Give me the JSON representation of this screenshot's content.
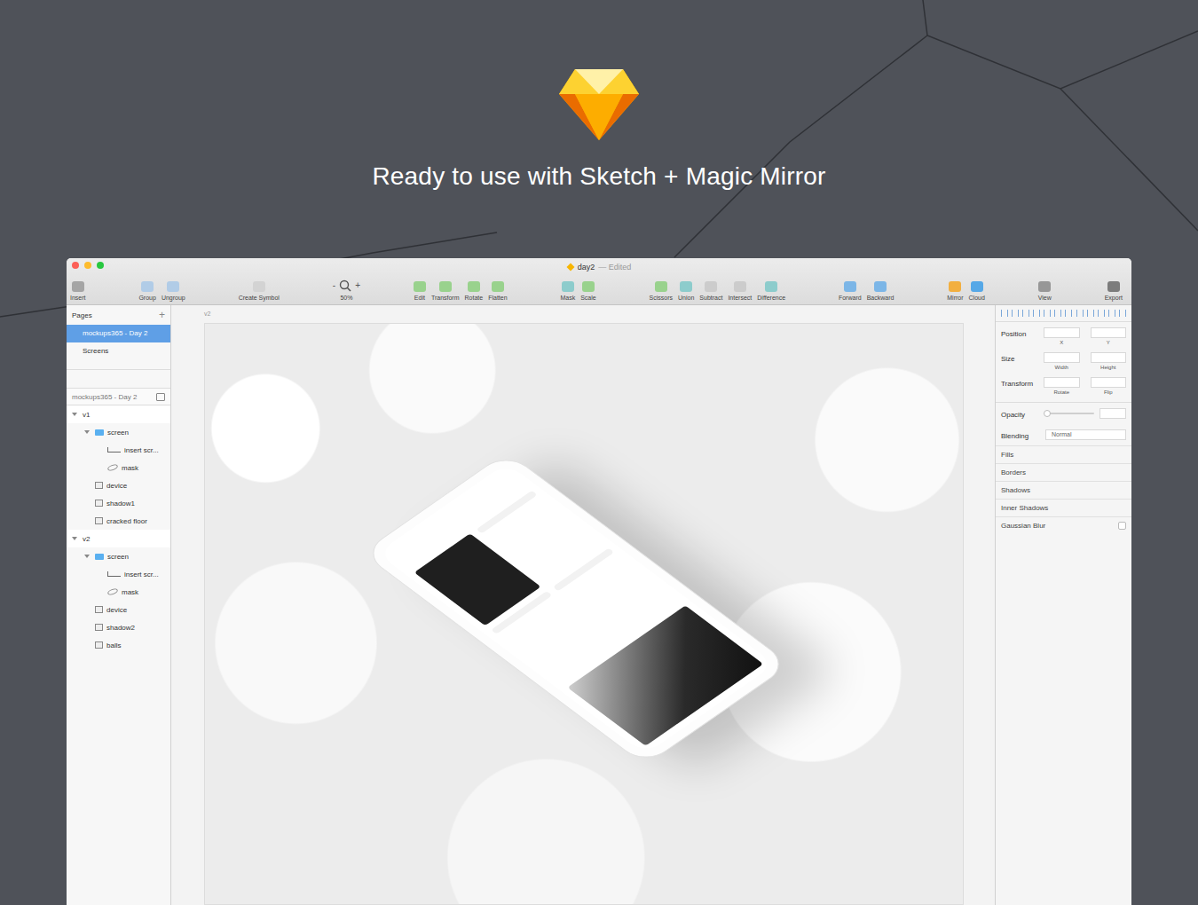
{
  "hero": {
    "title": "Ready to use with Sketch + Magic Mirror"
  },
  "window": {
    "title": "day2",
    "status": "— Edited"
  },
  "toolbar": {
    "groups": [
      [
        {
          "label": "Insert",
          "color": "#9a9a9a"
        }
      ],
      [
        {
          "label": "Group",
          "color": "#a8c8e8"
        },
        {
          "label": "Ungroup",
          "color": "#a8c8e8"
        }
      ],
      [
        {
          "label": "Create Symbol",
          "color": "#d0d0d0"
        }
      ],
      [],
      [
        {
          "label": "Edit",
          "color": "#8ccf7e"
        },
        {
          "label": "Transform",
          "color": "#8ccf7e"
        },
        {
          "label": "Rotate",
          "color": "#8ccf7e"
        },
        {
          "label": "Flatten",
          "color": "#8ccf7e"
        }
      ],
      [
        {
          "label": "Mask",
          "color": "#7ec8c8"
        },
        {
          "label": "Scale",
          "color": "#8ccf7e"
        }
      ],
      [
        {
          "label": "Scissors",
          "color": "#8ccf7e"
        },
        {
          "label": "Union",
          "color": "#7ec8c8"
        },
        {
          "label": "Subtract",
          "color": "#c8c8c8"
        },
        {
          "label": "Intersect",
          "color": "#c8c8c8"
        },
        {
          "label": "Difference",
          "color": "#7ec8c8"
        }
      ],
      [
        {
          "label": "Forward",
          "color": "#6aaee8"
        },
        {
          "label": "Backward",
          "color": "#6aaee8"
        }
      ],
      [
        {
          "label": "Mirror",
          "color": "#f5a623"
        },
        {
          "label": "Cloud",
          "color": "#3d9de8"
        }
      ],
      [
        {
          "label": "View",
          "color": "#8a8a8a"
        }
      ],
      [
        {
          "label": "Export",
          "color": "#6a6a6a"
        }
      ]
    ],
    "zoom": {
      "minus": "-",
      "plus": "+",
      "label": "50%"
    }
  },
  "pages": {
    "header": "Pages",
    "add": "+",
    "items": [
      {
        "label": "mockups365 - Day 2",
        "selected": true
      },
      {
        "label": "Screens",
        "selected": false
      }
    ]
  },
  "layers": {
    "header": "mockups365 - Day 2",
    "items": [
      {
        "label": "v1",
        "kind": "artboard",
        "depth": 0,
        "expanded": true
      },
      {
        "label": "screen",
        "kind": "group",
        "depth": 1,
        "expanded": true
      },
      {
        "label": "insert scr...",
        "kind": "masked",
        "depth": 2,
        "expanded": false
      },
      {
        "label": "mask",
        "kind": "shape",
        "depth": 2,
        "expanded": false
      },
      {
        "label": "device",
        "kind": "image",
        "depth": 1,
        "expanded": false
      },
      {
        "label": "shadow1",
        "kind": "image",
        "depth": 1,
        "expanded": false
      },
      {
        "label": "cracked floor",
        "kind": "image",
        "depth": 1,
        "expanded": false
      },
      {
        "label": "v2",
        "kind": "artboard",
        "depth": 0,
        "expanded": true
      },
      {
        "label": "screen",
        "kind": "group",
        "depth": 1,
        "expanded": true
      },
      {
        "label": "insert scr...",
        "kind": "masked",
        "depth": 2,
        "expanded": false
      },
      {
        "label": "mask",
        "kind": "shape",
        "depth": 2,
        "expanded": false
      },
      {
        "label": "device",
        "kind": "image",
        "depth": 1,
        "expanded": false
      },
      {
        "label": "shadow2",
        "kind": "image",
        "depth": 1,
        "expanded": false
      },
      {
        "label": "balls",
        "kind": "image",
        "depth": 1,
        "expanded": false
      }
    ]
  },
  "canvas": {
    "artboard": "v2"
  },
  "inspector": {
    "rows": [
      {
        "label": "Position",
        "fields": [
          {
            "label": "X",
            "value": ""
          },
          {
            "label": "Y",
            "value": ""
          }
        ]
      },
      {
        "label": "Size",
        "fields": [
          {
            "label": "Width",
            "value": ""
          },
          {
            "label": "Height",
            "value": ""
          }
        ]
      },
      {
        "label": "Transform",
        "fields": [
          {
            "label": "Rotate",
            "value": ""
          },
          {
            "label": "Flip",
            "value": ""
          }
        ]
      }
    ],
    "opacity": {
      "label": "Opacity",
      "level": 0,
      "value": ""
    },
    "blending": {
      "label": "Blending",
      "value": "Normal"
    },
    "sections": [
      "Fills",
      "Borders",
      "Shadows",
      "Inner Shadows"
    ],
    "blur": {
      "label": "Gaussian Blur",
      "checked": false
    }
  }
}
